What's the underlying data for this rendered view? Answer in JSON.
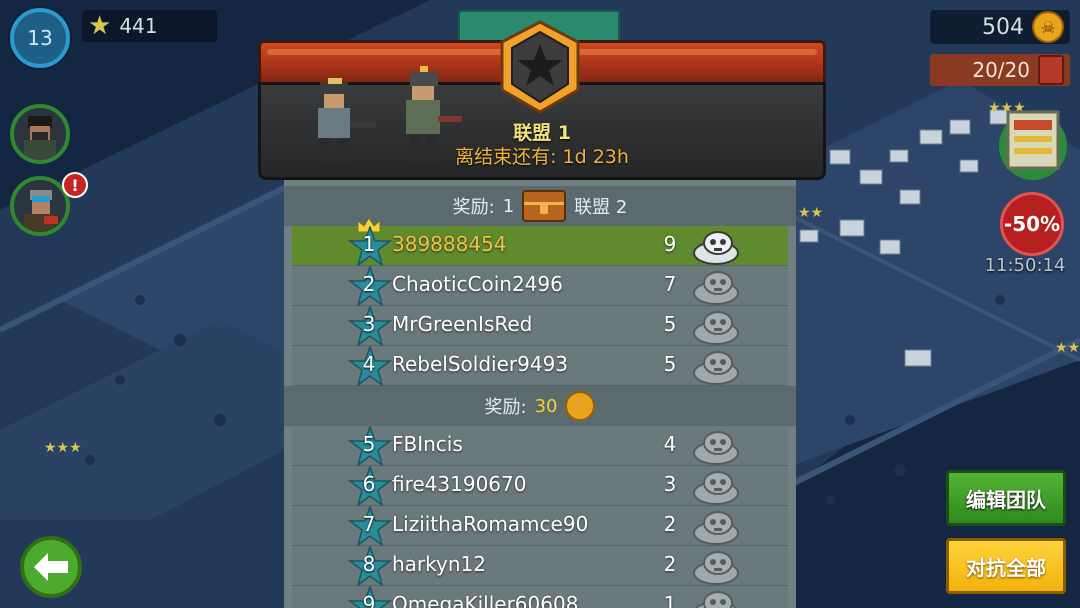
{
  "hud": {
    "level": "13",
    "stars": "441",
    "coins": "504",
    "fuel": "20/20",
    "discount": "-50%",
    "timer": "11:50:14"
  },
  "event": {
    "league_name": "联盟 1",
    "time_left": "离结束还有: 1d 23h"
  },
  "reward_promo": {
    "label": "奖励:",
    "chest_count": "1",
    "league_next": "联盟 2"
  },
  "reward_coins": {
    "label": "奖励:",
    "amount": "30"
  },
  "players": [
    {
      "rank": "1",
      "name": "389888454",
      "score": "9"
    },
    {
      "rank": "2",
      "name": "ChaoticCoin2496",
      "score": "7"
    },
    {
      "rank": "3",
      "name": "MrGreenIsRed",
      "score": "5"
    },
    {
      "rank": "4",
      "name": "RebelSoldier9493",
      "score": "5"
    },
    {
      "rank": "5",
      "name": "FBIncis",
      "score": "4"
    },
    {
      "rank": "6",
      "name": "fire43190670",
      "score": "3"
    },
    {
      "rank": "7",
      "name": "LiziithaRomamce90",
      "score": "2"
    },
    {
      "rank": "8",
      "name": "harkyn12",
      "score": "2"
    },
    {
      "rank": "9",
      "name": "OmegaKiller60608",
      "score": "1"
    }
  ],
  "buttons": {
    "edit_team": "编辑团队",
    "attack_all": "对抗全部"
  },
  "colors": {
    "me_row": "#5f8a2e",
    "rank_star": "#2a8c9a",
    "banner": "#c0401c"
  }
}
